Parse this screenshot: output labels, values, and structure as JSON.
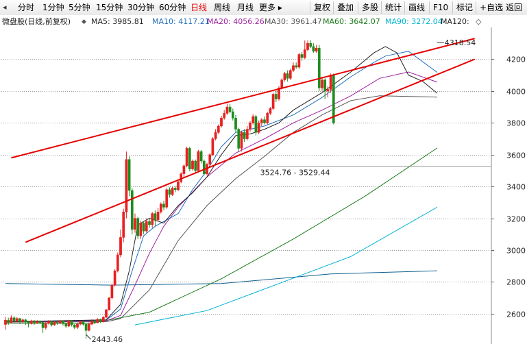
{
  "toolbar": {
    "left_items": [
      {
        "label": "分时",
        "active": false
      },
      {
        "label": "1分钟",
        "active": false
      },
      {
        "label": "5分钟",
        "active": false
      },
      {
        "label": "15分钟",
        "active": false
      },
      {
        "label": "30分钟",
        "active": false
      },
      {
        "label": "60分钟",
        "active": false
      },
      {
        "label": "日线",
        "active": true
      },
      {
        "label": "周线",
        "active": false
      },
      {
        "label": "月线",
        "active": false
      },
      {
        "label": "更多 ▸",
        "active": false
      }
    ],
    "right_items": [
      {
        "label": "复权"
      },
      {
        "label": "叠加"
      },
      {
        "label": "多股"
      },
      {
        "label": "统计"
      },
      {
        "label": "画线"
      },
      {
        "label": "F10"
      },
      {
        "label": "标记"
      },
      {
        "label": "+自选"
      },
      {
        "label": "返回"
      }
    ]
  },
  "legend": {
    "title": "微盘股(日线,前复权)",
    "title_dot": "◆",
    "items": [
      {
        "label": "MA5: 3985.81",
        "color": "#222222"
      },
      {
        "label": "MA10: 4117.21",
        "color": "#1f6fbf"
      },
      {
        "label": "MA20: 4056.26",
        "color": "#a020a0"
      },
      {
        "label": "MA30: 3961.47",
        "color": "#555555"
      },
      {
        "label": "MA60: 3642.07",
        "color": "#1a7a1a"
      },
      {
        "label": "MA90: 3272.04",
        "color": "#00b4d0"
      },
      {
        "label": "MA120:",
        "color": "#222222"
      }
    ],
    "tail": "◇"
  },
  "chart_data": {
    "type": "candlestick",
    "ylim": [
      2410,
      4400
    ],
    "y_ticks": [
      4200,
      4000,
      3800,
      3600,
      3400,
      3200,
      3000,
      2800,
      2600
    ],
    "colors": {
      "up": "#e82020",
      "down": "#1e8c1e",
      "grid": "#9a9a9a",
      "trendline": "#e60000"
    },
    "candles": [
      [
        2533,
        2560,
        2500,
        2580
      ],
      [
        2560,
        2545,
        2530,
        2575
      ],
      [
        2545,
        2575,
        2540,
        2590
      ],
      [
        2575,
        2555,
        2540,
        2585
      ],
      [
        2555,
        2570,
        2545,
        2580
      ],
      [
        2570,
        2550,
        2535,
        2575
      ],
      [
        2550,
        2562,
        2540,
        2570
      ],
      [
        2562,
        2548,
        2530,
        2568
      ],
      [
        2548,
        2538,
        2515,
        2552
      ],
      [
        2538,
        2556,
        2532,
        2562
      ],
      [
        2556,
        2542,
        2530,
        2560
      ],
      [
        2542,
        2552,
        2536,
        2560
      ],
      [
        2552,
        2545,
        2535,
        2558
      ],
      [
        2545,
        2512,
        2480,
        2550
      ],
      [
        2512,
        2540,
        2500,
        2548
      ],
      [
        2540,
        2552,
        2532,
        2560
      ],
      [
        2552,
        2530,
        2520,
        2556
      ],
      [
        2530,
        2548,
        2524,
        2555
      ],
      [
        2548,
        2540,
        2530,
        2552
      ],
      [
        2540,
        2555,
        2535,
        2560
      ],
      [
        2555,
        2538,
        2525,
        2558
      ],
      [
        2538,
        2522,
        2510,
        2542
      ],
      [
        2522,
        2556,
        2516,
        2562
      ],
      [
        2556,
        2530,
        2520,
        2560
      ],
      [
        2530,
        2515,
        2503,
        2535
      ],
      [
        2515,
        2535,
        2505,
        2545
      ],
      [
        2535,
        2550,
        2527,
        2558
      ],
      [
        2550,
        2534,
        2525,
        2555
      ],
      [
        2534,
        2495,
        2443,
        2540
      ],
      [
        2495,
        2535,
        2490,
        2545
      ],
      [
        2535,
        2555,
        2528,
        2565
      ],
      [
        2555,
        2545,
        2535,
        2560
      ],
      [
        2545,
        2565,
        2540,
        2572
      ],
      [
        2565,
        2550,
        2541,
        2570
      ],
      [
        2550,
        2578,
        2545,
        2585
      ],
      [
        2578,
        2625,
        2572,
        2630
      ],
      [
        2625,
        2700,
        2620,
        2705
      ],
      [
        2700,
        2780,
        2690,
        2790
      ],
      [
        2780,
        2870,
        2770,
        2880
      ],
      [
        2870,
        2970,
        2860,
        2985
      ],
      [
        2970,
        3080,
        2955,
        3130
      ],
      [
        3080,
        3240,
        3050,
        3260
      ],
      [
        3240,
        3570,
        3200,
        3620
      ],
      [
        3570,
        3375,
        3340,
        3590
      ],
      [
        3375,
        3130,
        3100,
        3390
      ],
      [
        3130,
        3200,
        3110,
        3230
      ],
      [
        3200,
        3090,
        3070,
        3210
      ],
      [
        3090,
        3170,
        3070,
        3185
      ],
      [
        3170,
        3120,
        3100,
        3180
      ],
      [
        3120,
        3180,
        3110,
        3200
      ],
      [
        3180,
        3160,
        3140,
        3200
      ],
      [
        3160,
        3230,
        3140,
        3240
      ],
      [
        3230,
        3190,
        3150,
        3250
      ],
      [
        3190,
        3240,
        3180,
        3265
      ],
      [
        3240,
        3290,
        3230,
        3300
      ],
      [
        3290,
        3270,
        3250,
        3310
      ],
      [
        3270,
        3380,
        3260,
        3390
      ],
      [
        3380,
        3350,
        3330,
        3395
      ],
      [
        3350,
        3390,
        3340,
        3400
      ],
      [
        3390,
        3380,
        3365,
        3400
      ],
      [
        3380,
        3430,
        3370,
        3440
      ],
      [
        3430,
        3480,
        3420,
        3490
      ],
      [
        3480,
        3530,
        3460,
        3540
      ],
      [
        3530,
        3640,
        3520,
        3650
      ],
      [
        3640,
        3510,
        3495,
        3650
      ],
      [
        3510,
        3560,
        3500,
        3570
      ],
      [
        3560,
        3500,
        3485,
        3570
      ],
      [
        3500,
        3620,
        3490,
        3630
      ],
      [
        3620,
        3560,
        3545,
        3630
      ],
      [
        3560,
        3480,
        3470,
        3570
      ],
      [
        3480,
        3540,
        3470,
        3550
      ],
      [
        3540,
        3600,
        3530,
        3610
      ],
      [
        3600,
        3700,
        3590,
        3710
      ],
      [
        3700,
        3740,
        3690,
        3760
      ],
      [
        3740,
        3780,
        3730,
        3790
      ],
      [
        3780,
        3830,
        3770,
        3845
      ],
      [
        3830,
        3860,
        3820,
        3880
      ],
      [
        3860,
        3900,
        3850,
        3920
      ],
      [
        3900,
        3870,
        3860,
        3920
      ],
      [
        3870,
        3830,
        3815,
        3890
      ],
      [
        3830,
        3760,
        3740,
        3850
      ],
      [
        3760,
        3640,
        3620,
        3770
      ],
      [
        3640,
        3740,
        3620,
        3750
      ],
      [
        3740,
        3700,
        3680,
        3760
      ],
      [
        3700,
        3760,
        3690,
        3780
      ],
      [
        3760,
        3800,
        3745,
        3812
      ],
      [
        3800,
        3840,
        3790,
        3855
      ],
      [
        3840,
        3740,
        3720,
        3850
      ],
      [
        3740,
        3800,
        3730,
        3815
      ],
      [
        3800,
        3820,
        3780,
        3830
      ],
      [
        3820,
        3800,
        3790,
        3840
      ],
      [
        3800,
        3860,
        3790,
        3870
      ],
      [
        3860,
        3890,
        3850,
        3900
      ],
      [
        3890,
        3980,
        3880,
        3990
      ],
      [
        3980,
        3950,
        3930,
        4000
      ],
      [
        3950,
        4020,
        3940,
        4030
      ],
      [
        4020,
        4070,
        4010,
        4080
      ],
      [
        4070,
        4110,
        4060,
        4120
      ],
      [
        4110,
        4080,
        4060,
        4130
      ],
      [
        4080,
        4130,
        4070,
        4140
      ],
      [
        4130,
        4160,
        4120,
        4180
      ],
      [
        4160,
        4150,
        4140,
        4180
      ],
      [
        4150,
        4230,
        4140,
        4240
      ],
      [
        4230,
        4210,
        4190,
        4245
      ],
      [
        4210,
        4260,
        4200,
        4318
      ],
      [
        4260,
        4300,
        4250,
        4318
      ],
      [
        4300,
        4280,
        4270,
        4320
      ],
      [
        4280,
        4250,
        4240,
        4300
      ],
      [
        4250,
        4270,
        4240,
        4290
      ],
      [
        4270,
        4020,
        4000,
        4290
      ],
      [
        4020,
        4070,
        4000,
        4090
      ],
      [
        4070,
        4000,
        3950,
        4080
      ],
      [
        4000,
        4010,
        3960,
        4030
      ],
      [
        4010,
        4100,
        3990,
        4110
      ],
      [
        4100,
        3800,
        3790,
        4110
      ]
    ],
    "ma_lines": [
      {
        "name": "MA120",
        "color": "#0f5f8f",
        "points": [
          [
            0,
            2790
          ],
          [
            37,
            2780
          ],
          [
            75,
            2790
          ],
          [
            113,
            2850
          ],
          [
            150,
            2870
          ]
        ]
      },
      {
        "name": "MA90",
        "color": "#00b4d0",
        "points": [
          [
            45,
            2530
          ],
          [
            70,
            2620
          ],
          [
            95,
            2790
          ],
          [
            120,
            2960
          ],
          [
            150,
            3270
          ]
        ]
      },
      {
        "name": "MA60",
        "color": "#1a7a1a",
        "points": [
          [
            0,
            2540
          ],
          [
            30,
            2540
          ],
          [
            50,
            2610
          ],
          [
            75,
            2820
          ],
          [
            100,
            3070
          ],
          [
            125,
            3340
          ],
          [
            150,
            3642
          ]
        ]
      },
      {
        "name": "MA30",
        "color": "#555555",
        "points": [
          [
            0,
            2548
          ],
          [
            35,
            2550
          ],
          [
            40,
            2570
          ],
          [
            50,
            2750
          ],
          [
            60,
            3060
          ],
          [
            70,
            3280
          ],
          [
            80,
            3450
          ],
          [
            90,
            3590
          ],
          [
            100,
            3740
          ],
          [
            110,
            3850
          ],
          [
            120,
            3940
          ],
          [
            130,
            3970
          ],
          [
            150,
            3962
          ]
        ]
      },
      {
        "name": "MA20",
        "color": "#a020a0",
        "points": [
          [
            0,
            2548
          ],
          [
            35,
            2555
          ],
          [
            40,
            2590
          ],
          [
            45,
            2780
          ],
          [
            50,
            2980
          ],
          [
            55,
            3150
          ],
          [
            60,
            3270
          ],
          [
            70,
            3460
          ],
          [
            80,
            3610
          ],
          [
            90,
            3700
          ],
          [
            100,
            3800
          ],
          [
            110,
            3880
          ],
          [
            120,
            3970
          ],
          [
            130,
            4080
          ],
          [
            140,
            4120
          ],
          [
            150,
            4056
          ]
        ]
      },
      {
        "name": "MA10",
        "color": "#1f6fbf",
        "points": [
          [
            0,
            2550
          ],
          [
            35,
            2560
          ],
          [
            40,
            2630
          ],
          [
            44,
            2870
          ],
          [
            48,
            3090
          ],
          [
            52,
            3150
          ],
          [
            60,
            3230
          ],
          [
            65,
            3380
          ],
          [
            70,
            3500
          ],
          [
            75,
            3650
          ],
          [
            80,
            3740
          ],
          [
            85,
            3760
          ],
          [
            90,
            3780
          ],
          [
            100,
            3850
          ],
          [
            110,
            3960
          ],
          [
            120,
            4090
          ],
          [
            128,
            4180
          ],
          [
            132,
            4220
          ],
          [
            140,
            4250
          ],
          [
            150,
            4117
          ]
        ]
      },
      {
        "name": "MA5",
        "color": "#222222",
        "points": [
          [
            0,
            2550
          ],
          [
            35,
            2562
          ],
          [
            40,
            2660
          ],
          [
            43,
            2870
          ],
          [
            46,
            3160
          ],
          [
            50,
            3200
          ],
          [
            55,
            3170
          ],
          [
            60,
            3280
          ],
          [
            65,
            3360
          ],
          [
            70,
            3460
          ],
          [
            75,
            3600
          ],
          [
            80,
            3720
          ],
          [
            85,
            3730
          ],
          [
            90,
            3760
          ],
          [
            95,
            3800
          ],
          [
            100,
            3880
          ],
          [
            110,
            3990
          ],
          [
            120,
            4120
          ],
          [
            128,
            4240
          ],
          [
            132,
            4280
          ],
          [
            136,
            4240
          ],
          [
            140,
            4100
          ],
          [
            145,
            4060
          ],
          [
            150,
            3986
          ]
        ]
      }
    ],
    "trendlines": [
      {
        "from": [
          2,
          3580
        ],
        "to": [
          163,
          4330
        ]
      },
      {
        "from": [
          7,
          3050
        ],
        "to": [
          163,
          4200
        ]
      }
    ],
    "annotations": {
      "high": "4318.54",
      "low": "2443.46",
      "range": "3524.76 - 3529.44",
      "range_value": 3527
    }
  }
}
